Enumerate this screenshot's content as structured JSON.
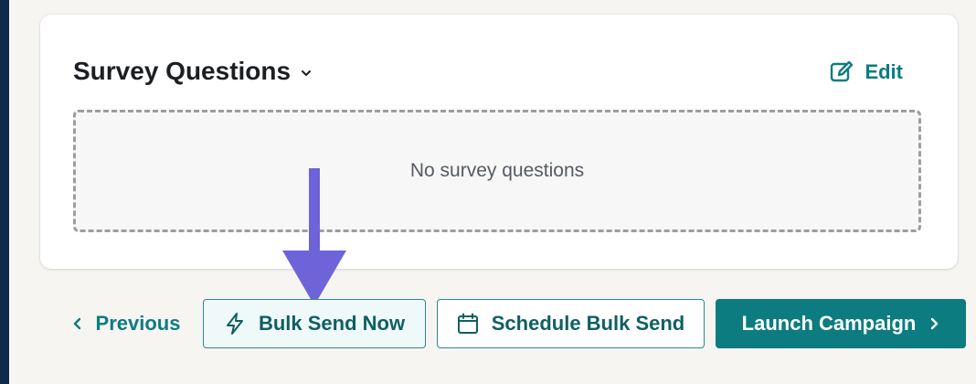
{
  "survey": {
    "title": "Survey Questions",
    "edit_label": "Edit",
    "empty_message": "No survey questions"
  },
  "footer": {
    "previous_label": "Previous",
    "bulk_send_label": "Bulk Send Now",
    "schedule_label": "Schedule Bulk Send",
    "launch_label": "Launch Campaign"
  },
  "colors": {
    "accent": "#0c7c80",
    "annotation_arrow": "#6f63d9",
    "sidebar": "#0f2a4a"
  },
  "icons": [
    "chevron-down-icon",
    "edit-icon",
    "chevron-left-icon",
    "lightning-icon",
    "calendar-icon",
    "chevron-right-icon"
  ]
}
